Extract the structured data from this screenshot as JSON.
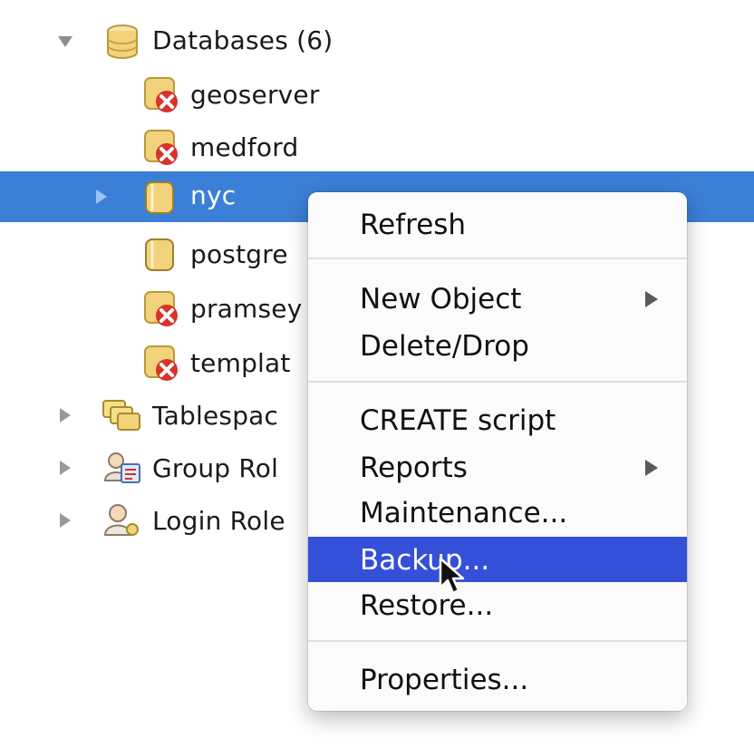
{
  "tree": {
    "databases_label": "Databases (6)",
    "databases": [
      {
        "name": "geoserver",
        "status": "disconnected"
      },
      {
        "name": "medford",
        "status": "disconnected"
      },
      {
        "name": "nyc",
        "status": "connected",
        "selected": true
      },
      {
        "name": "postgre",
        "status": "connected"
      },
      {
        "name": "pramsey",
        "status": "disconnected"
      },
      {
        "name": "templat",
        "status": "disconnected"
      }
    ],
    "other_nodes": [
      {
        "name": "Tablespac",
        "icon": "tablespace-icon"
      },
      {
        "name": "Group Rol",
        "icon": "group-roles-icon"
      },
      {
        "name": "Login Role",
        "icon": "login-roles-icon"
      }
    ]
  },
  "context_menu": {
    "items": [
      {
        "label": "Refresh",
        "submenu": false
      },
      {
        "label": "New Object",
        "submenu": true
      },
      {
        "label": "Delete/Drop",
        "submenu": false
      },
      {
        "label": "CREATE script",
        "submenu": false
      },
      {
        "label": "Reports",
        "submenu": true
      },
      {
        "label": "Maintenance...",
        "submenu": false
      },
      {
        "label": "Backup...",
        "submenu": false,
        "highlighted": true
      },
      {
        "label": "Restore...",
        "submenu": false
      },
      {
        "label": "Properties...",
        "submenu": false
      }
    ]
  },
  "colors": {
    "selection": "#3b7fd6",
    "menu_highlight": "#3550d8",
    "db_icon": "#f2d27a",
    "error_x": "#d8322a"
  }
}
